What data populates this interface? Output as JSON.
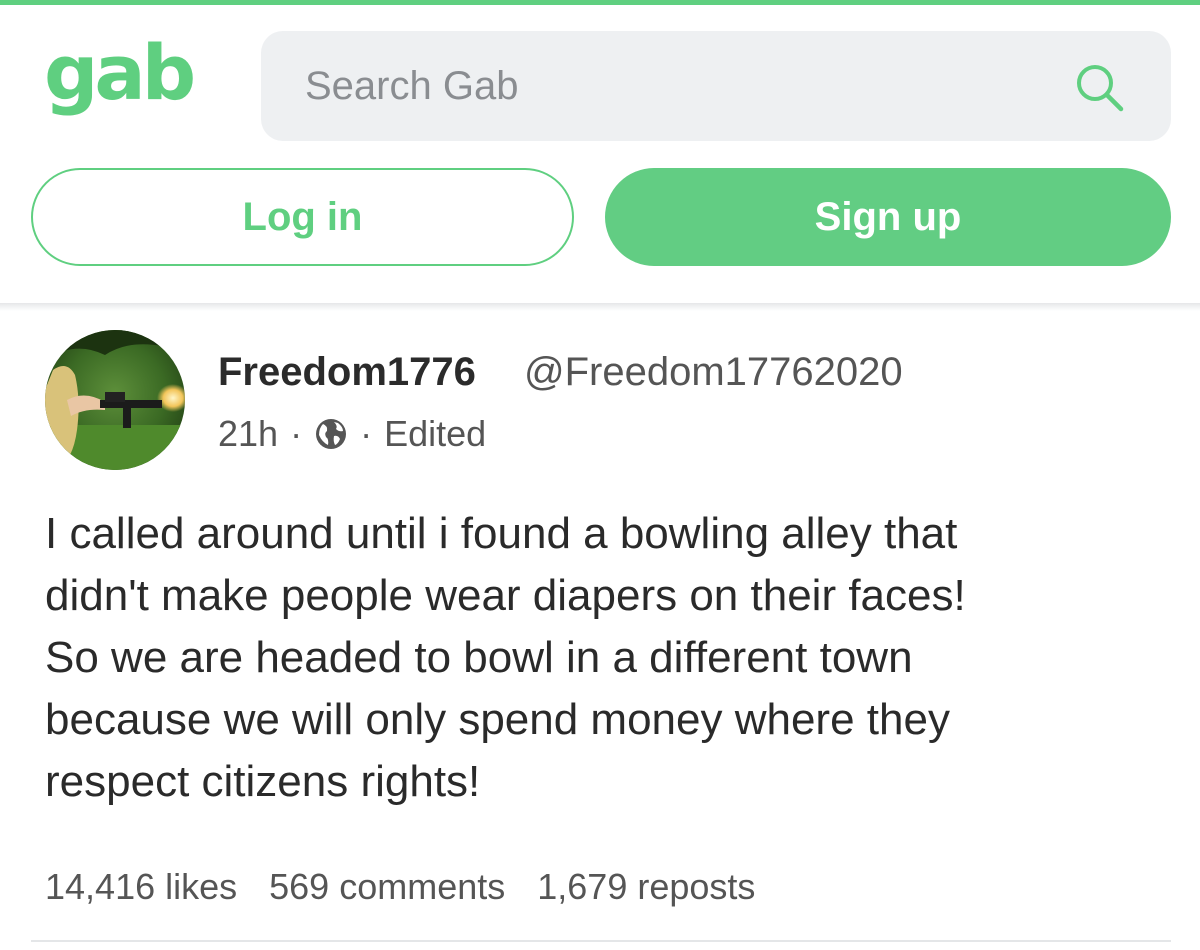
{
  "brand": {
    "logo_text": "gab",
    "accent_color": "#5fcf80"
  },
  "search": {
    "placeholder": "Search Gab",
    "value": "",
    "icon": "search-icon"
  },
  "auth": {
    "login_label": "Log in",
    "signup_label": "Sign up"
  },
  "post": {
    "display_name": "Freedom1776",
    "handle": "@Freedom17762020",
    "time": "21h",
    "separator": "·",
    "visibility_icon": "globe-icon",
    "edited_label": "Edited",
    "text_lines": [
      "I called around until i found a bowling alley that",
      "didn't make people wear diapers on their faces!",
      "So we are headed to bowl in a different town",
      "because we will only spend money where they",
      "respect citizens rights!"
    ],
    "stats": {
      "likes": "14,416 likes",
      "comments": "569 comments",
      "reposts": "1,679 reposts"
    }
  }
}
